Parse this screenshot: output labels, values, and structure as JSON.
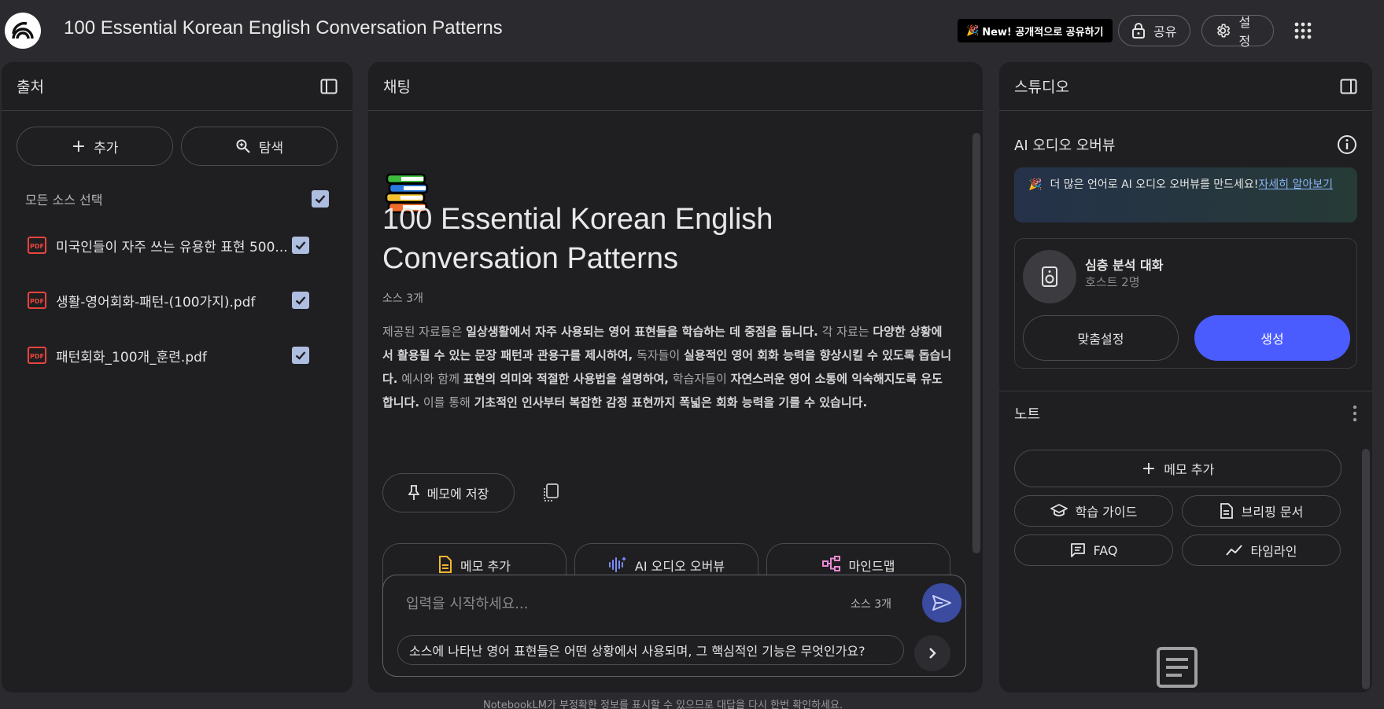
{
  "header": {
    "title": "100 Essential Korean English Conversation Patterns",
    "new_share_label": "New! 공개적으로 공유하기",
    "share_label": "공유",
    "settings_label": "설정"
  },
  "sources": {
    "panel_title": "출처",
    "add_label": "추가",
    "explore_label": "탐색",
    "select_all_label": "모든 소스 선택",
    "items": [
      {
        "name": "미국인들이 자주 쓰는 유용한 표현 500..."
      },
      {
        "name": "생활-영어회화-패턴-(100가지).pdf"
      },
      {
        "name": "패턴회화_100개_훈련.pdf"
      }
    ]
  },
  "chat": {
    "panel_title": "채팅",
    "notebook_title": "100 Essential Korean English Conversation Patterns",
    "source_count": "소스 3개",
    "summary": [
      {
        "t": "제공된 자료들은 ",
        "b": false
      },
      {
        "t": "일상생활에서 자주 사용되는 영어 표현들을 학습하는 데 중점을 둡니다.",
        "b": true
      },
      {
        "t": " 각 자료는 ",
        "b": false
      },
      {
        "t": "다양한 상황에서 활용될 수 있는 문장 패턴과 관용구를 제시하여,",
        "b": true
      },
      {
        "t": " 독자들이 ",
        "b": false
      },
      {
        "t": "실용적인 영어 회화 능력을 향상시킬 수 있도록 돕습니다.",
        "b": true
      },
      {
        "t": " 예시와 함께 ",
        "b": false
      },
      {
        "t": "표현의 의미와 적절한 사용법을 설명하여,",
        "b": true
      },
      {
        "t": " 학습자들이 ",
        "b": false
      },
      {
        "t": "자연스러운 영어 소통에 익숙해지도록 유도합니다.",
        "b": true
      },
      {
        "t": " 이를 통해 ",
        "b": false
      },
      {
        "t": "기초적인 인사부터 복잡한 감정 표현까지 폭넓은 회화 능력을 기를 수 있습니다.",
        "b": true
      }
    ],
    "save_memo_label": "메모에 저장",
    "suggest_buttons": [
      "메모 추가",
      "AI 오디오 오버뷰",
      "마인드맵"
    ],
    "composer_placeholder": "입력을 시작하세요...",
    "composer_source_count": "소스 3개",
    "suggested_question": "소스에 나타난 영어 표현들은 어떤 상황에서 사용되며, 그 핵심적인 기능은 무엇인가요?",
    "disclaimer": "NotebookLM가 부정확한 정보를 표시할 수 있으므로 대답을 다시 한번 확인하세요."
  },
  "studio": {
    "panel_title": "스튜디오",
    "audio_title": "AI 오디오 오버뷰",
    "banner_text": "더 많은 언어로 AI 오디오 오버뷰를 만드세요!",
    "banner_link": "자세히 알아보기",
    "deep_title": "심층 분석 대화",
    "deep_sub": "호스트 2명",
    "customize_label": "맞춤설정",
    "generate_label": "생성",
    "notes_title": "노트",
    "add_note_label": "메모 추가",
    "note_buttons": [
      "학습 가이드",
      "브리핑 문서",
      "FAQ",
      "타임라인"
    ]
  },
  "colors": {
    "accent": "#4b5cff",
    "background": "#2b2b2f",
    "panel": "#1f1f22"
  }
}
